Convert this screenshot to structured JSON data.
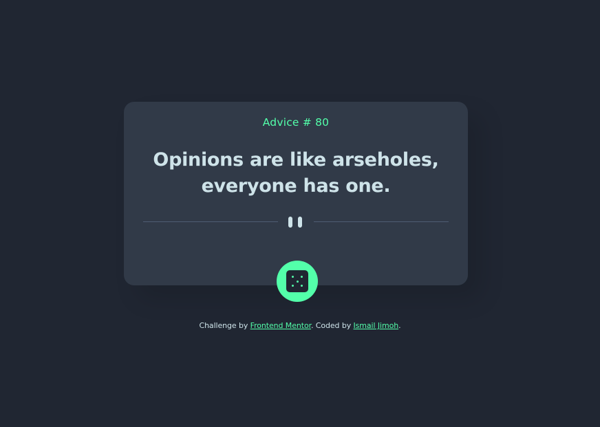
{
  "advice": {
    "id_label": "Advice # 80",
    "line1": "Opinions are like arseholes,",
    "line2": "everyone has one."
  },
  "divider": {
    "icon": "pause-icon"
  },
  "dice_button": {
    "icon": "dice-icon"
  },
  "footer": {
    "prefix": "Challenge by ",
    "frontend_mentor": "Frontend Mentor",
    "middle": ". Coded by ",
    "author": "Ismail Jimoh",
    "suffix": "."
  },
  "colors": {
    "background": "#202632",
    "card": "#313a48",
    "accent": "#53ffaa",
    "text": "#cee3e9",
    "divider": "#4f5d74"
  }
}
